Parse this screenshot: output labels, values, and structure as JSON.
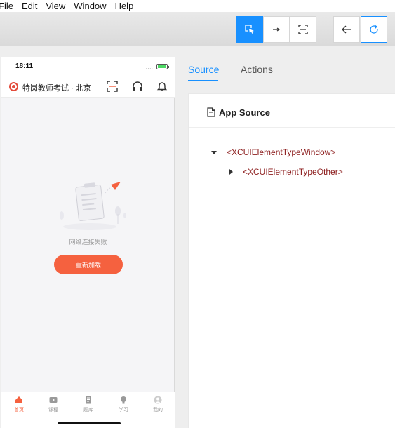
{
  "menu": [
    "File",
    "Edit",
    "View",
    "Window",
    "Help"
  ],
  "toolbar": {
    "buttons": [
      {
        "name": "select-elements-button",
        "icon": "select-icon",
        "active": true
      },
      {
        "name": "swipe-button",
        "icon": "arrow-right-icon",
        "active": false
      },
      {
        "name": "tap-by-coordinates-button",
        "icon": "crop-icon",
        "active": false
      },
      {
        "name": "back-button",
        "icon": "arrow-left-icon",
        "active": false
      },
      {
        "name": "refresh-button",
        "icon": "refresh-icon",
        "active": false
      }
    ],
    "accent": "#1890ff"
  },
  "device": {
    "time": "18:11",
    "signal": "....",
    "app_title": "特岗教师考试 · 北京",
    "error_text": "网络连接失败",
    "reload_label": "重新加载",
    "accent": "#f5613f",
    "tabs": [
      {
        "label": "首页",
        "icon": "home-icon",
        "active": true
      },
      {
        "label": "课程",
        "icon": "video-icon",
        "active": false
      },
      {
        "label": "题库",
        "icon": "book-icon",
        "active": false
      },
      {
        "label": "学习",
        "icon": "bulb-icon",
        "active": false
      },
      {
        "label": "我的",
        "icon": "user-icon",
        "active": false
      }
    ]
  },
  "inspector": {
    "tabs": [
      "Source",
      "Actions"
    ],
    "active_tab": "Source",
    "card_title": "App Source",
    "tree": [
      {
        "label": "<XCUIElementTypeWindow>",
        "expanded": true
      },
      {
        "label": "<XCUIElementTypeOther>",
        "expanded": false
      }
    ]
  }
}
